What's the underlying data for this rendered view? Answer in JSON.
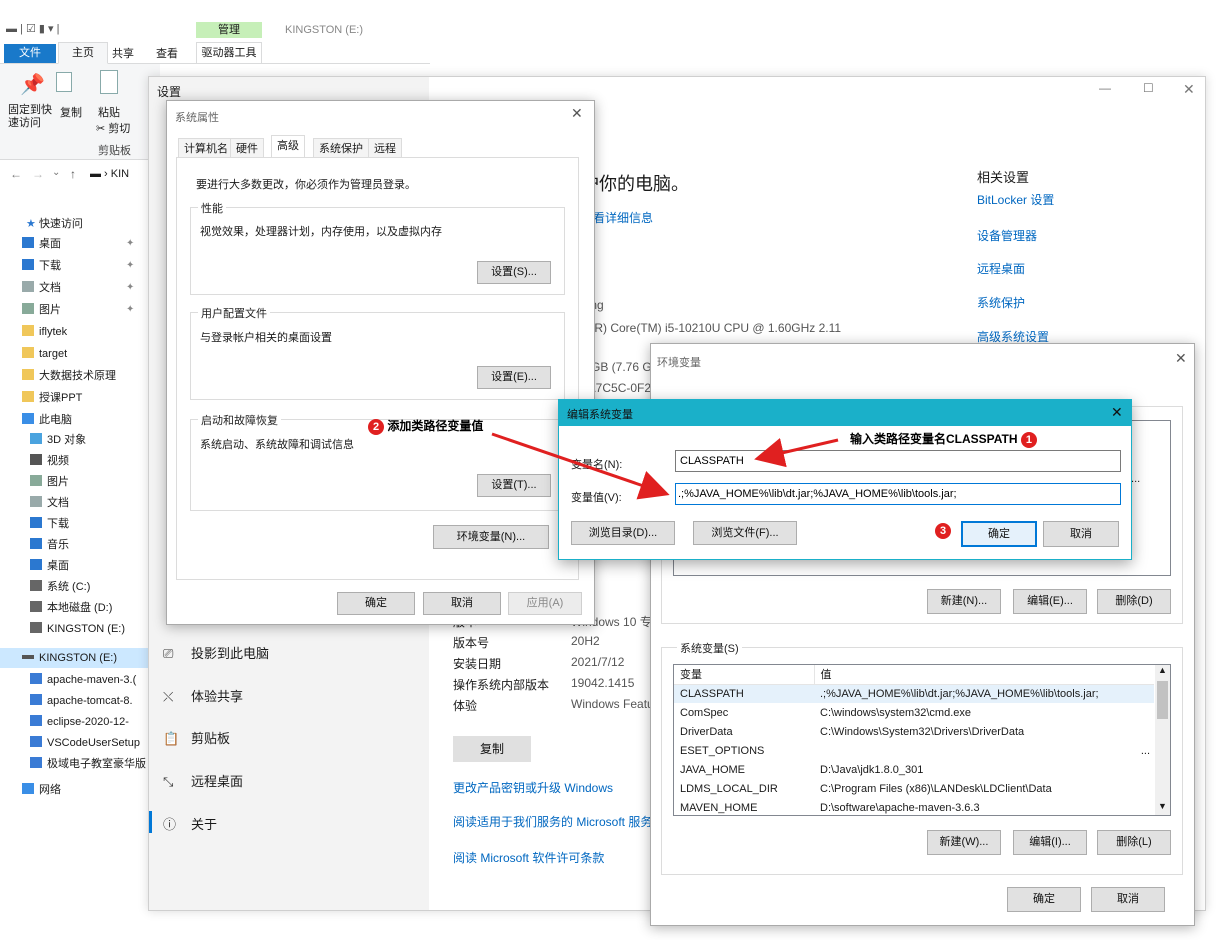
{
  "explorer": {
    "ribbon_tabs": [
      "文件",
      "主页",
      "共享",
      "查看"
    ],
    "manage_tab": "管理",
    "drive_tools": "驱动器工具",
    "window_title": "KINGSTON (E:)",
    "ribbon": {
      "pin": "固定到快速访问",
      "pin_line1": "固定到快",
      "pin_line2": "速访问",
      "copy": "复制",
      "paste": "粘贴",
      "cut": "剪切",
      "clipboard_group": "剪贴板"
    },
    "address_fragment": "KIN",
    "nav": {
      "quick_access": "快速访问",
      "items": [
        {
          "label": "桌面",
          "pinned": true,
          "icon": "desktop-icon"
        },
        {
          "label": "下载",
          "pinned": true,
          "icon": "download-icon"
        },
        {
          "label": "文档",
          "pinned": true,
          "icon": "document-icon"
        },
        {
          "label": "图片",
          "pinned": true,
          "icon": "picture-icon"
        },
        {
          "label": "iflytek",
          "pinned": false,
          "icon": "folder-icon"
        },
        {
          "label": "target",
          "pinned": false,
          "icon": "folder-icon"
        },
        {
          "label": "大数据技术原理",
          "pinned": false,
          "icon": "folder-icon"
        },
        {
          "label": "授课PPT",
          "pinned": false,
          "icon": "folder-icon"
        }
      ],
      "this_pc": "此电脑",
      "pc_items": [
        "3D 对象",
        "视频",
        "图片",
        "文档",
        "下载",
        "音乐",
        "桌面",
        "系统 (C:)",
        "本地磁盘 (D:)",
        "KINGSTON (E:)"
      ],
      "drive_selected": "KINGSTON (E:)",
      "drive_items": [
        "apache-maven-3.(",
        "apache-tomcat-8.",
        "eclipse-2020-12-",
        "VSCodeUserSetup",
        "极域电子教室豪华版"
      ],
      "network": "网络"
    }
  },
  "settings": {
    "title": "设置",
    "heading_fragment": "护你的电脑。",
    "details_link": "查看详细信息",
    "related_title": "相关设置",
    "related_links": [
      "BitLocker 设置",
      "设备管理器",
      "远程桌面",
      "系统保护",
      "高级系统设置"
    ],
    "spec_fragments": [
      "ning",
      "el(R) Core(TM) i5-10210U CPU @ 1.60GHz   2.11",
      "z",
      "0 GB (7.76 G",
      "0A7C5C-0F2"
    ],
    "left_nav": [
      {
        "label": "投影到此电脑",
        "icon": "projector-icon"
      },
      {
        "label": "体验共享",
        "icon": "share-icon"
      },
      {
        "label": "剪贴板",
        "icon": "clipboard-icon"
      },
      {
        "label": "远程桌面",
        "icon": "remote-desktop-icon"
      },
      {
        "label": "关于",
        "icon": "info-icon"
      }
    ],
    "win_spec": [
      {
        "k": "版本",
        "v": "Windows 10 专"
      },
      {
        "k": "版本号",
        "v": "20H2"
      },
      {
        "k": "安装日期",
        "v": "2021/7/12"
      },
      {
        "k": "操作系统内部版本",
        "v": "19042.1415"
      },
      {
        "k": "体验",
        "v": "Windows Featu"
      }
    ],
    "copy_button": "复制",
    "bottom_links": [
      "更改产品密钥或升级 Windows",
      "阅读适用于我们服务的 Microsoft 服务",
      "阅读 Microsoft 软件许可条款"
    ]
  },
  "sysprops": {
    "title": "系统属性",
    "tabs": [
      "计算机名",
      "硬件",
      "高级",
      "系统保护",
      "远程"
    ],
    "active_tab": "高级",
    "admin_note": "要进行大多数更改，你必须作为管理员登录。",
    "perf_label": "性能",
    "perf_desc": "视觉效果，处理器计划，内存使用，以及虚拟内存",
    "perf_btn": "设置(S)...",
    "profile_label": "用户配置文件",
    "profile_desc": "与登录帐户相关的桌面设置",
    "profile_btn": "设置(E)...",
    "startup_label": "启动和故障恢复",
    "startup_desc": "系统启动、系统故障和调试信息",
    "startup_btn": "设置(T)...",
    "env_btn": "环境变量(N)...",
    "ok": "确定",
    "cancel": "取消",
    "apply": "应用(A)"
  },
  "envvars": {
    "title": "环境变量",
    "user_new": "新建(N)...",
    "user_edit": "编辑(E)...",
    "user_delete": "删除(D)",
    "user_row_fragment": "\\...",
    "sys_label": "系统变量(S)",
    "col_var": "变量",
    "col_val": "值",
    "rows": [
      {
        "name": "CLASSPATH",
        "value": ".;%JAVA_HOME%\\lib\\dt.jar;%JAVA_HOME%\\lib\\tools.jar;"
      },
      {
        "name": "ComSpec",
        "value": "C:\\windows\\system32\\cmd.exe"
      },
      {
        "name": "DriverData",
        "value": "C:\\Windows\\System32\\Drivers\\DriverData"
      },
      {
        "name": "ESET_OPTIONS",
        "value": ""
      },
      {
        "name": "JAVA_HOME",
        "value": "D:\\Java\\jdk1.8.0_301"
      },
      {
        "name": "LDMS_LOCAL_DIR",
        "value": "C:\\Program Files (x86)\\LANDesk\\LDClient\\Data"
      },
      {
        "name": "MAVEN_HOME",
        "value": "D:\\software\\apache-maven-3.6.3"
      }
    ],
    "eset_ellipsis": "...",
    "sys_new": "新建(W)...",
    "sys_edit": "编辑(I)...",
    "sys_delete": "删除(L)",
    "ok": "确定",
    "cancel": "取消"
  },
  "editdlg": {
    "title": "编辑系统变量",
    "name_label": "变量名(N):",
    "value_label": "变量值(V):",
    "name_value": "CLASSPATH",
    "value_value": ".;%JAVA_HOME%\\lib\\dt.jar;%JAVA_HOME%\\lib\\tools.jar;",
    "browse_dir": "浏览目录(D)...",
    "browse_file": "浏览文件(F)...",
    "ok": "确定",
    "cancel": "取消"
  },
  "annotations": {
    "a1_text": "输入类路径变量名CLASSPATH",
    "a1_num": "1",
    "a2_text": "添加类路径变量值",
    "a2_num": "2",
    "a3_num": "3"
  },
  "colors": {
    "accent_blue": "#0078d7",
    "edit_titlebar": "#1ab0c9",
    "annotation_red": "#e02020",
    "link_blue": "#0067c0",
    "manage_tab_green": "#c6efb8",
    "file_tab_blue": "#1979ca"
  }
}
